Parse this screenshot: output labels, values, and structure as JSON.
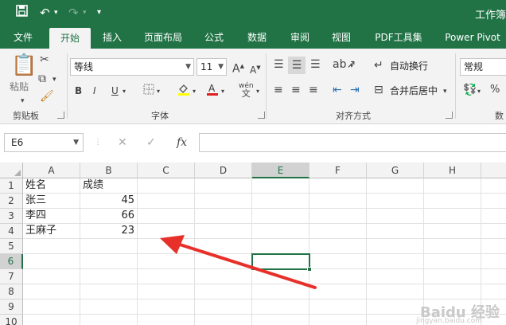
{
  "title_bar": {
    "title": "工作簿",
    "save_icon": "save-icon",
    "undo_icon": "undo-icon",
    "redo_icon": "redo-icon",
    "customize_icon": "customize-qat-icon"
  },
  "tabs": [
    {
      "label": "文件"
    },
    {
      "label": "开始",
      "active": true
    },
    {
      "label": "插入"
    },
    {
      "label": "页面布局"
    },
    {
      "label": "公式"
    },
    {
      "label": "数据"
    },
    {
      "label": "审阅"
    },
    {
      "label": "视图"
    },
    {
      "label": "PDF工具集"
    },
    {
      "label": "Power Pivot"
    }
  ],
  "ribbon": {
    "clipboard": {
      "paste_label": "粘贴",
      "group_label": "剪贴板"
    },
    "font": {
      "font_name": "等线",
      "font_size": "11",
      "grow": "A",
      "shrink": "A",
      "bold": "B",
      "italic": "I",
      "underline": "U",
      "phonetic": "wén",
      "group_label": "字体"
    },
    "alignment": {
      "wrap_text": "自动换行",
      "merge_center": "合并后居中",
      "group_label": "对齐方式"
    },
    "number": {
      "format": "常规",
      "percent": "%",
      "group_label": "数"
    }
  },
  "formula_bar": {
    "name_box": "E6",
    "fx": "fx",
    "cancel": "✕",
    "enter": "✓",
    "formula": ""
  },
  "sheet": {
    "columns": [
      "A",
      "B",
      "C",
      "D",
      "E",
      "F",
      "G",
      "H"
    ],
    "rows": [
      "1",
      "2",
      "3",
      "4",
      "5",
      "6",
      "7",
      "8",
      "9",
      "10"
    ],
    "cells": {
      "A1": "姓名",
      "B1": "成绩",
      "A2": "张三",
      "B2": "45",
      "A3": "李四",
      "B3": "66",
      "A4": "王麻子",
      "B4": "23"
    },
    "active_cell": "E6"
  },
  "annotation": {
    "arrow_color": "#e8302a"
  },
  "colors": {
    "accent": "#217346"
  },
  "watermark": {
    "text": "Baidu 经验",
    "sub": "jingyan.baidu.com"
  }
}
